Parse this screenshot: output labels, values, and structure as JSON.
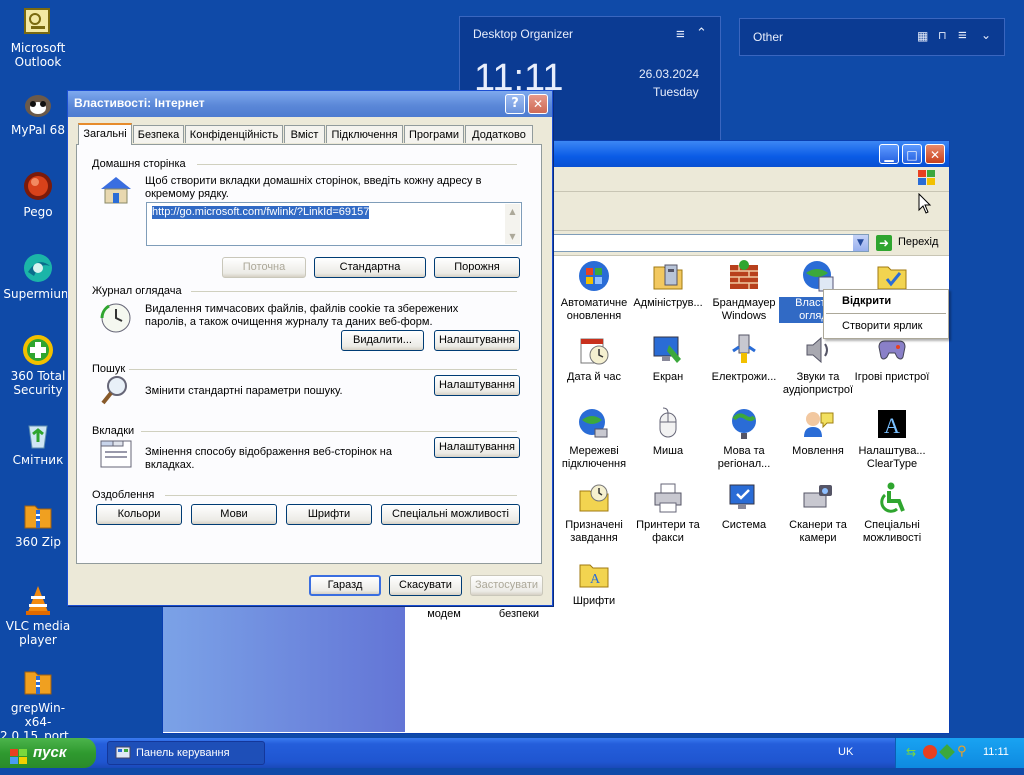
{
  "desktop": {
    "icons": [
      {
        "label": "Microsoft Outlook",
        "icon": "outlook-icon"
      },
      {
        "label": "MyPal 68",
        "icon": "mypal-icon"
      },
      {
        "label": "Pego",
        "icon": "pego-icon"
      },
      {
        "label": "Supermium",
        "icon": "supermium-icon"
      },
      {
        "label": "360 Total Security",
        "icon": "shield-plus-icon"
      },
      {
        "label": "Смітник",
        "icon": "recycle-bin-icon"
      },
      {
        "label": "360 Zip",
        "icon": "zip-icon"
      },
      {
        "label": "VLC media player",
        "icon": "vlc-cone-icon"
      },
      {
        "label": "grepWin-x64-2.0.15_port...",
        "icon": "archive-icon"
      }
    ]
  },
  "organizer": {
    "title": "Desktop Organizer",
    "time": "11:11",
    "date": "26.03.2024",
    "weekday": "Tuesday",
    "other_title": "Other"
  },
  "control_panel": {
    "go_label": "Перехід",
    "context_menu": [
      "Відкрити",
      "Створити ярлик"
    ],
    "items": [
      {
        "label": "Автоматичне оновлення",
        "icon": "windows-update-icon"
      },
      {
        "label": "Адмініструв...",
        "icon": "admin-tools-icon"
      },
      {
        "label": "Брандмауер Windows",
        "icon": "firewall-icon"
      },
      {
        "label": "Власти... огляд...",
        "icon": "internet-options-icon"
      },
      {
        "label": "",
        "icon": "folder-options-icon"
      },
      {
        "label": "Дата й час",
        "icon": "clock-icon"
      },
      {
        "label": "Екран",
        "icon": "display-icon"
      },
      {
        "label": "Електрожи...",
        "icon": "power-icon"
      },
      {
        "label": "Звуки та аудіопристрої",
        "icon": "speaker-icon"
      },
      {
        "label": "Ігрові пристрої",
        "icon": "gamepad-icon"
      },
      {
        "label": "Мережеві підключення",
        "icon": "network-icon"
      },
      {
        "label": "Миша",
        "icon": "mouse-icon"
      },
      {
        "label": "Мова та регіонал...",
        "icon": "globe-icon"
      },
      {
        "label": "Мовлення",
        "icon": "speech-icon"
      },
      {
        "label": "Налаштува... ClearType",
        "icon": "cleartype-icon"
      },
      {
        "label": "Призначені завдання",
        "icon": "scheduled-tasks-icon"
      },
      {
        "label": "Принтери та факси",
        "icon": "printer-icon"
      },
      {
        "label": "Система",
        "icon": "system-icon"
      },
      {
        "label": "Сканери та камери",
        "icon": "scanner-icon"
      },
      {
        "label": "Спеціальні можливості",
        "icon": "accessibility-icon"
      },
      {
        "label": "Шрифти",
        "icon": "fonts-folder-icon"
      }
    ],
    "bottom_labels": [
      "модем",
      "безпеки"
    ]
  },
  "dialog": {
    "title": "Властивості: Інтернет",
    "tabs": [
      "Загальні",
      "Безпека",
      "Конфіденційність",
      "Вміст",
      "Підключення",
      "Програми",
      "Додатково"
    ],
    "home": {
      "group": "Домашня сторінка",
      "description": "Щоб створити вкладки домашніх сторінок, введіть кожну адресу в окремому рядку.",
      "url": "http://go.microsoft.com/fwlink/?LinkId=69157",
      "btn_current": "Поточна",
      "btn_default": "Стандартна",
      "btn_blank": "Порожня"
    },
    "history": {
      "group": "Журнал оглядача",
      "description": "Видалення тимчасових файлів, файлів cookie та збережених паролів, а також очищення журналу та даних веб-форм.",
      "btn_delete": "Видалити...",
      "btn_settings": "Налаштування"
    },
    "search": {
      "group": "Пошук",
      "description": "Змінити стандартні параметри пошуку.",
      "btn_settings": "Налаштування"
    },
    "tabs_group": {
      "group": "Вкладки",
      "description": "Змінення способу відображення веб-сторінок на вкладках.",
      "btn_settings": "Налаштування"
    },
    "appearance": {
      "group": "Оздоблення",
      "btn_colors": "Кольори",
      "btn_languages": "Мови",
      "btn_fonts": "Шрифти",
      "btn_accessibility": "Спеціальні можливості"
    },
    "btn_ok": "Гаразд",
    "btn_cancel": "Скасувати",
    "btn_apply": "Застосувати"
  },
  "taskbar": {
    "start_label": "пуск",
    "task": "Панель керування",
    "language": "UK",
    "time": "11:11"
  }
}
